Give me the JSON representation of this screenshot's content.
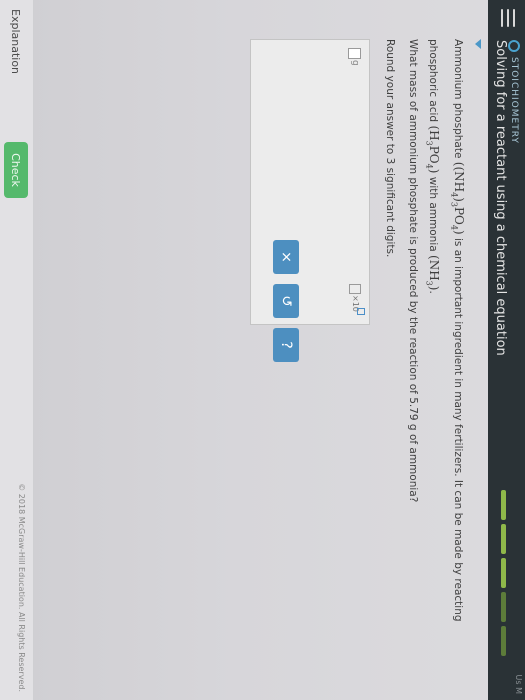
{
  "header": {
    "topic": "STOICHIOMETRY",
    "title": "Solving for a reactant using a chemical equation",
    "corner_text": "Us M"
  },
  "question": {
    "intro": "Ammonium phosphate",
    "formula_ammonium_phosphate": {
      "a": "(",
      "b": "(NH",
      "c": "4",
      "d": ")",
      "e": "3",
      "f": "PO",
      "g": "4",
      "h": ")"
    },
    "mid1": "is an important ingredient in many fertilizers. It can be made by reacting",
    "mid2": "phosphoric acid",
    "formula_phosphoric": {
      "a": "(H",
      "b": "3",
      "c": "PO",
      "d": "4",
      "e": ")"
    },
    "mid3": "with ammonia",
    "formula_ammonia": {
      "a": "(NH",
      "b": "3",
      "c": ")"
    },
    "end": ".",
    "line2": "What mass of ammonium phosphate is produced by the reaction of 5.79 g of ammonia?",
    "line3": "Round your answer to 3 significant digits."
  },
  "answer": {
    "unit": "g",
    "x10": "×10"
  },
  "keypad": {
    "clear": "×",
    "undo": "↺",
    "help": "?"
  },
  "footer": {
    "explanation": "Explanation",
    "check": "Check",
    "copyright": "© 2018 McGraw-Hill Education. All Rights Reserved."
  }
}
